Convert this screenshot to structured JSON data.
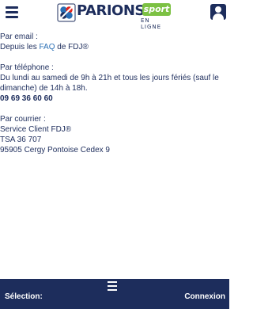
{
  "header": {
    "logo": {
      "brand": "PARIONS",
      "badge": "sport",
      "tagline": "EN LIGNE"
    },
    "icons": {
      "menu": "hamburger-menu-icon",
      "account": "user-account-icon",
      "logo": "fdj-clover-icon"
    }
  },
  "contact": {
    "email": {
      "title": "Par email :",
      "prefix": "Depuis les ",
      "link": "FAQ",
      "suffix": " de FDJ®"
    },
    "phone": {
      "title": "Par téléphone :",
      "hours": "Du lundi au samedi de 9h à 21h et tous les jours fériés (sauf le dimanche) de 14h à 18h.",
      "number": "09 69 36 60 60"
    },
    "mail": {
      "title": "Par courrier :",
      "line1": "Service Client FDJ®",
      "line2": "TSA 36 707",
      "line3": "95905 Cergy Pontoise Cedex 9"
    }
  },
  "footer": {
    "selection": "Sélection:",
    "login": "Connexion",
    "menu_icon": "hamburger-menu-icon"
  },
  "colors": {
    "primary": "#1d2d5c",
    "link": "#2a6fb5",
    "sport_green": "#7cc143",
    "clover_red": "#e2231a"
  }
}
